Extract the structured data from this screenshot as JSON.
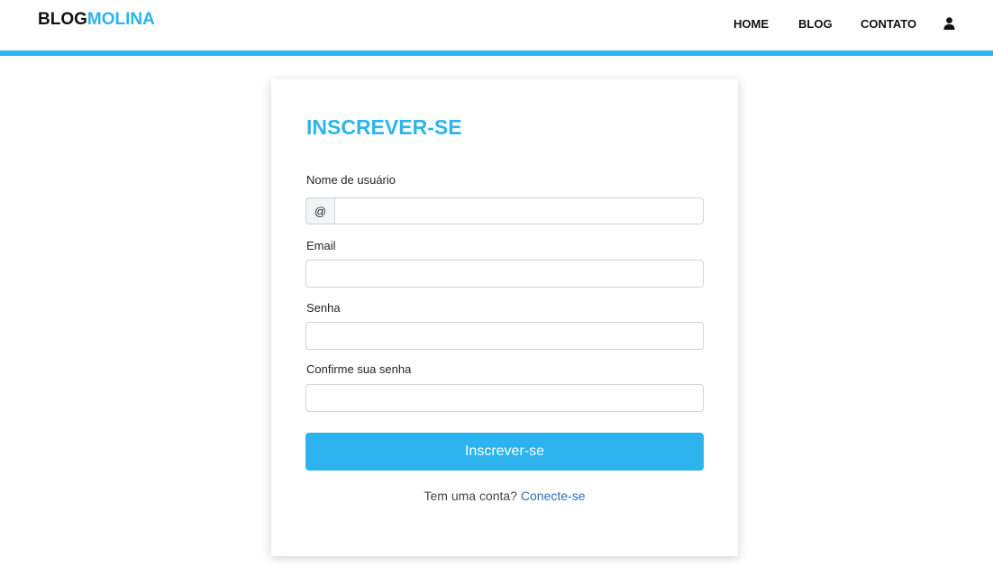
{
  "brand": {
    "part1": "BLOG",
    "part2": "MOLINA"
  },
  "nav": {
    "home": "HOME",
    "blog": "BLOG",
    "contato": "CONTATO",
    "user_icon": "user-icon"
  },
  "form": {
    "title": "INSCREVER-SE",
    "username": {
      "label": "Nome de usuário",
      "prefix": "@",
      "value": ""
    },
    "email": {
      "label": "Email",
      "value": ""
    },
    "password": {
      "label": "Senha",
      "value": ""
    },
    "confirm_password": {
      "label": "Confirme sua senha",
      "value": ""
    },
    "submit_label": "Inscrever-se",
    "login_prompt": "Tem uma conta?",
    "login_link": "Conecte-se"
  },
  "colors": {
    "accent": "#2db4ee",
    "link": "#2e6eb5",
    "text": "#212529"
  }
}
